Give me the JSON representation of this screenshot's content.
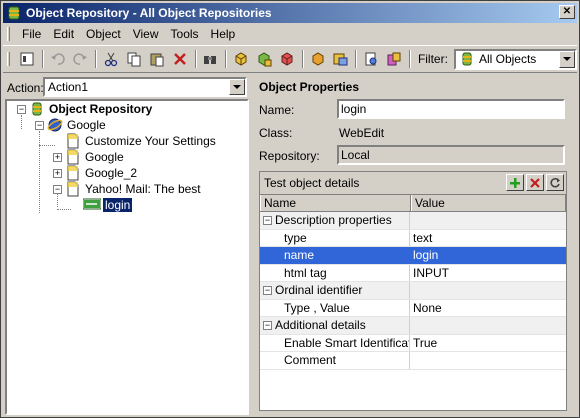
{
  "window": {
    "title": "Object Repository - All Object Repositories"
  },
  "menu": {
    "items": [
      {
        "label": "File"
      },
      {
        "label": "Edit"
      },
      {
        "label": "Object"
      },
      {
        "label": "View"
      },
      {
        "label": "Tools"
      },
      {
        "label": "Help"
      }
    ]
  },
  "toolbar": {
    "filter_label": "Filter:",
    "filter_value": "All Objects",
    "icons": [
      "object-repository-icon",
      "undo-icon",
      "redo-icon",
      "cut-icon",
      "copy-icon",
      "paste-icon",
      "delete-icon",
      "find-icon",
      "add-objects-icon",
      "highlight-icon",
      "locate-icon",
      "export-icon",
      "import-icon",
      "object-spy-icon",
      "merge-icon"
    ]
  },
  "action": {
    "label": "Action:",
    "value": "Action1"
  },
  "tree": {
    "root": "Object Repository",
    "browser": "Google",
    "pages": [
      "Customize Your Settings",
      "Google",
      "Google_2",
      "Yahoo! Mail: The best"
    ],
    "selected": "login"
  },
  "properties": {
    "title": "Object Properties",
    "name_label": "Name:",
    "name_value": "login",
    "class_label": "Class:",
    "class_value": "WebEdit",
    "repository_label": "Repository:",
    "repository_value": "Local",
    "details_title": "Test object details",
    "col_name": "Name",
    "col_value": "Value",
    "groups": {
      "description": "Description properties",
      "ordinal": "Ordinal identifier",
      "additional": "Additional details"
    },
    "rows": {
      "type": {
        "name": "type",
        "value": "text"
      },
      "name": {
        "name": "name",
        "value": "login"
      },
      "html_tag": {
        "name": "html tag",
        "value": "INPUT"
      },
      "type_value": {
        "name": "Type , Value",
        "value": "None"
      },
      "smart": {
        "name": "Enable Smart Identification",
        "value": "True"
      },
      "comment": {
        "name": "Comment",
        "value": ""
      }
    }
  },
  "colors": {
    "title_start": "#0a246a",
    "title_end": "#a6caf0",
    "selection": "#3166d8",
    "tree_selection": "#0a246a"
  }
}
